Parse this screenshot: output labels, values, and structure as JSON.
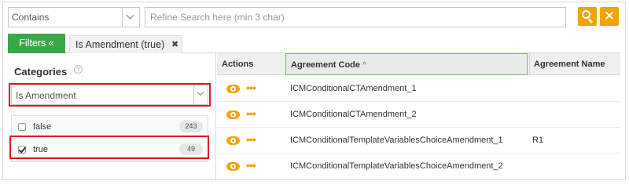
{
  "search": {
    "match_mode": "Contains",
    "placeholder": "Refine Search here (min 3 char)",
    "value": ""
  },
  "filters": {
    "toggle_label": "Filters «",
    "active_chip": "Is Amendment (true)",
    "chip_remove": "✖"
  },
  "categories": {
    "title": "Categories",
    "help": "?",
    "selected": "Is Amendment",
    "facets": [
      {
        "label": "false",
        "count": "243",
        "checked": false
      },
      {
        "label": "true",
        "count": "49",
        "checked": true
      }
    ]
  },
  "grid": {
    "columns": {
      "actions": "Actions",
      "code": "Agreement Code",
      "code_sort": "^",
      "name": "Agreement Name"
    },
    "rows": [
      {
        "code": "ICMConditionalCTAmendment_1",
        "name": ""
      },
      {
        "code": "ICMConditionalCTAmendment_2",
        "name": ""
      },
      {
        "code": "ICMConditionalTemplateVariablesChoiceAmendment_1",
        "name": "R1"
      },
      {
        "code": "ICMConditionalTemplateVariablesChoiceAmendment_2",
        "name": ""
      }
    ],
    "action_more": "•••"
  },
  "colors": {
    "accent_orange": "#f0a30a",
    "filter_green": "#3aa845",
    "highlight_red": "#e0161f"
  }
}
